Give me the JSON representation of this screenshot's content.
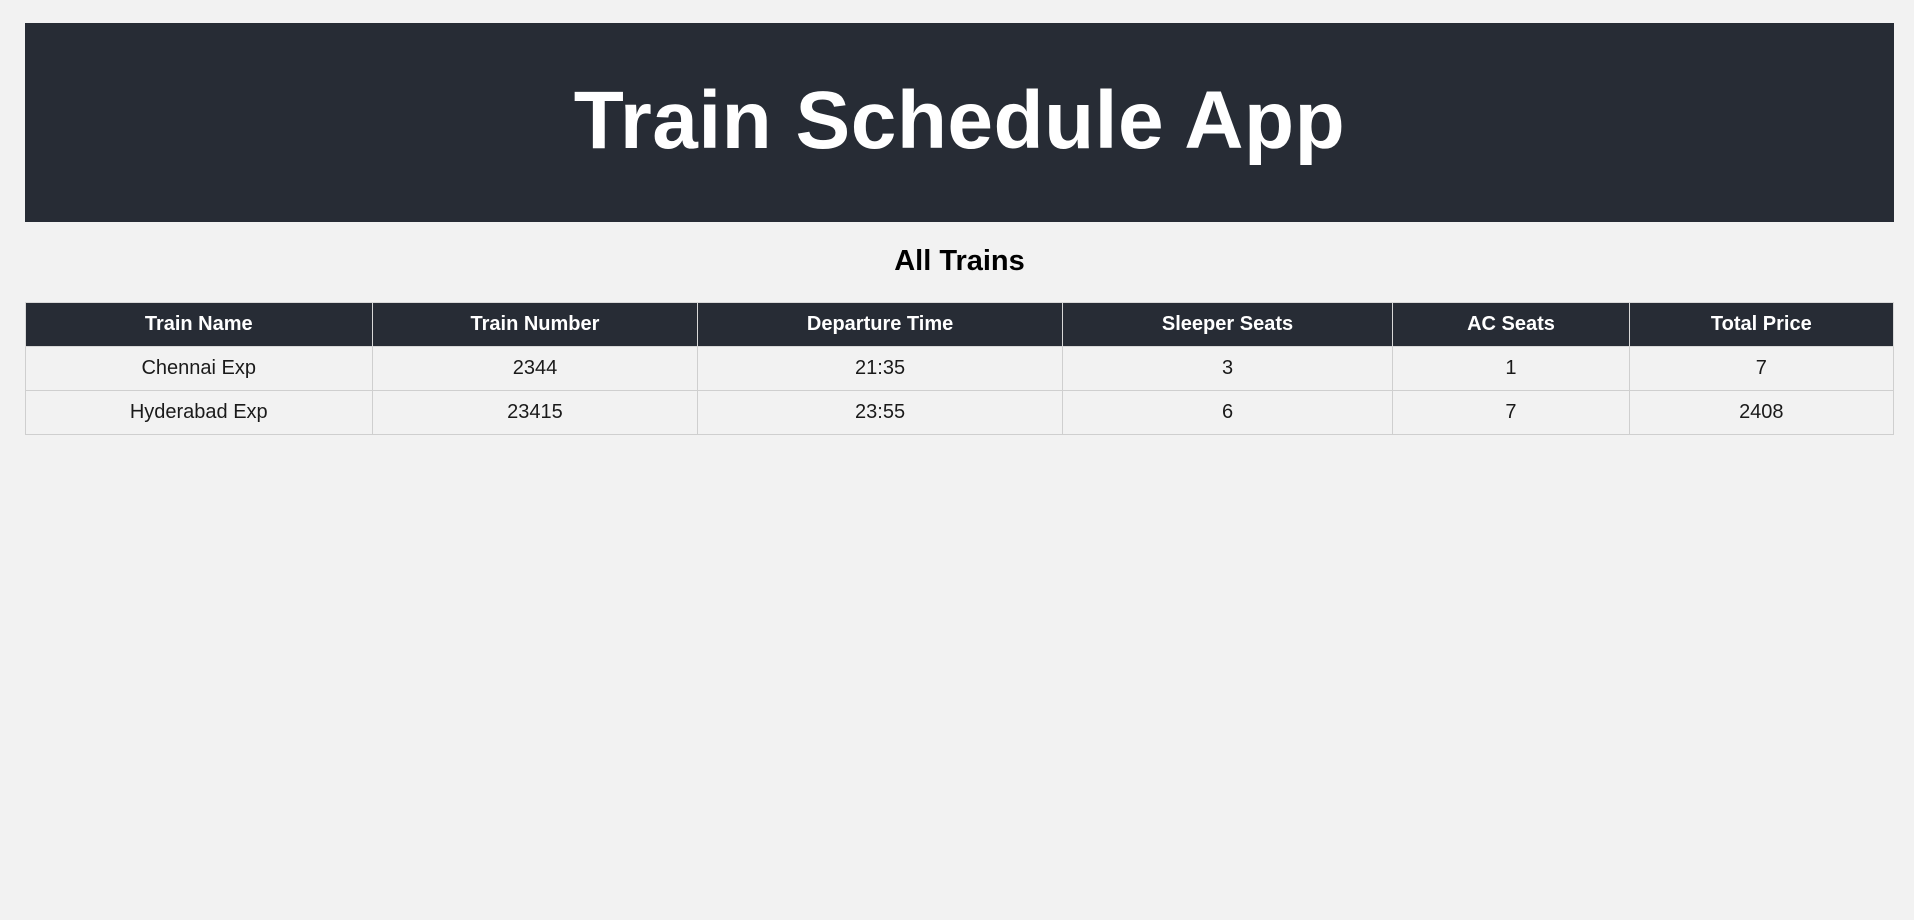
{
  "header": {
    "title": "Train Schedule App"
  },
  "section": {
    "title": "All Trains"
  },
  "table": {
    "columns": [
      "Train Name",
      "Train Number",
      "Departure Time",
      "Sleeper Seats",
      "AC Seats",
      "Total Price"
    ],
    "rows": [
      [
        "Chennai Exp",
        "2344",
        "21:35",
        "3",
        "1",
        "7"
      ],
      [
        "Hyderabad Exp",
        "23415",
        "23:55",
        "6",
        "7",
        "2408"
      ]
    ]
  },
  "colors": {
    "header_bg": "#272c35",
    "page_bg": "#f2f2f2"
  }
}
